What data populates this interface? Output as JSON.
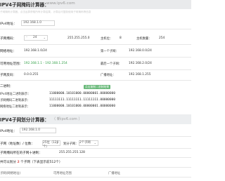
{
  "section1": {
    "title": "IPV4子网掩码计算器：",
    "site": "www.ipv6.com",
    "subtitle": "子网掩码计算器，点击运算获取所有计算结果，计算后可复制使用子网掩码等信息",
    "ip_label": "IPv4地址：",
    "ip_value": "192.168.1.0",
    "mask_label": "子网掩码：",
    "mask_bits": "24",
    "mask_value": "255.255.255.0",
    "host_bits_label": "主机位：",
    "host_bits_value": "8",
    "host_count_label": "主机数量：",
    "host_count_value": "254",
    "network_label": "网络地址：",
    "network_value": "192.168.1.0/24",
    "first_label": "第一个子网：",
    "first_value": "192.168.0.0/24",
    "range_label": "可用地址范围：",
    "range_value": "192.168.1.1 - 192.168.1.254",
    "last_label": "最后一个子网：",
    "last_value": "192.168.2.0/24",
    "wildcard_label": "子网反码：",
    "wildcard_value": "0.0.0.255",
    "broadcast_label": "广播地址：",
    "broadcast_value": "192.168.1.255",
    "binary_label": "二进制：",
    "copy_button": "点击复制二进制结果",
    "bin_ip_label": "IPv4地址二进制表示：",
    "bin_ip_value": "11000000.10101000.00000001.00000000",
    "bin_mask_label": "子网掩码二进制表示：",
    "bin_mask_value": "11111111.11111111.11111111.00000000",
    "bin_net_label": "网络地址二进制表示：",
    "bin_net_value": "11000000.10101000.00000001.00000000"
  },
  "section2": {
    "title": "IPV4子网划分计算器：",
    "site": "（ 新ipv6.com ）",
    "ip_label": "IPv4地址：",
    "ip_value": "192.168.1.0",
    "bits_label": "子网（地址数）/ 位数：",
    "bits_select": "25位（128个）",
    "bits_select2": "划分子网：",
    "bits_select3": "2个子网",
    "mask_label": "子网掩码所在的子网十进制：",
    "mask_value": "255.255.255.128",
    "result_label_pre": "共可以划分",
    "result_count": "2",
    "result_label_post": "个子网（下表显示前512个）",
    "col1": "子网(网络地址)",
    "col2": "可用地址范围",
    "col3": "广播地址"
  }
}
